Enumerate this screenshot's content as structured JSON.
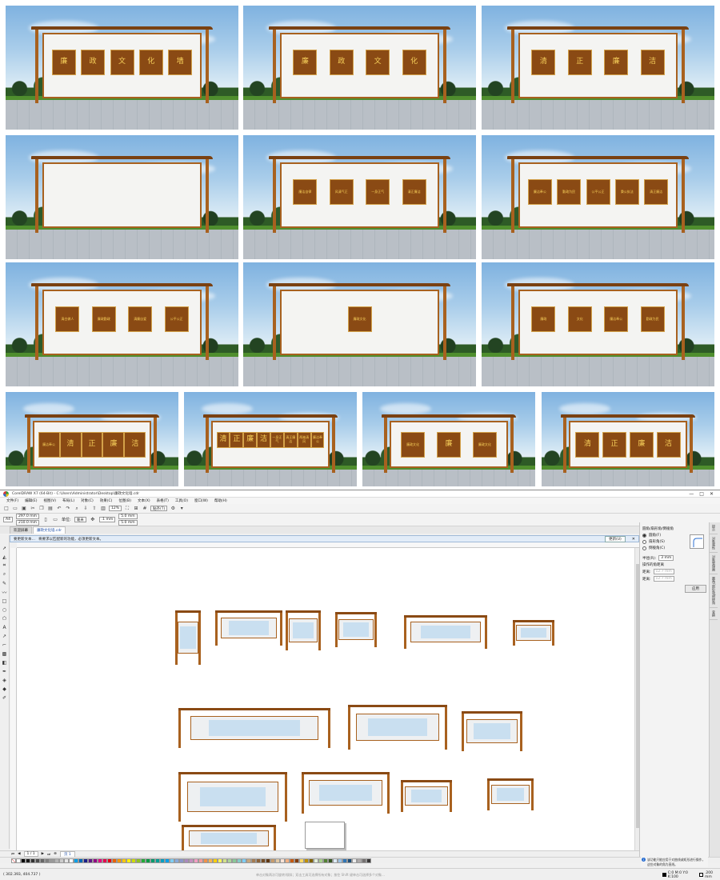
{
  "renders": [
    {
      "id": "r1",
      "signs": [
        "廉",
        "政",
        "文",
        "化",
        "墙"
      ]
    },
    {
      "id": "r2",
      "signs": [
        "廉",
        "政",
        "文",
        "化"
      ]
    },
    {
      "id": "r3",
      "signs": [
        "清",
        "正",
        "廉",
        "洁"
      ]
    },
    {
      "id": "r4",
      "signs": []
    },
    {
      "id": "r5",
      "signs": [
        "廉洁自律",
        "风清气正",
        "一身正气",
        "清正廉洁"
      ]
    },
    {
      "id": "r6",
      "signs": [
        "廉洁奉公",
        "勤政为民",
        "公平公正",
        "秉公执法",
        "清正廉洁"
      ]
    },
    {
      "id": "r7",
      "signs": [
        "清白做人",
        "廉政勤政",
        "清廉自爱",
        "公平公正"
      ]
    },
    {
      "id": "r8",
      "signs": [
        "廉政文化"
      ]
    },
    {
      "id": "r9",
      "signs": [
        "廉政",
        "文化",
        "廉洁奉公",
        "勤政为民"
      ]
    },
    {
      "id": "r10",
      "signs": [
        "廉洁奉公",
        "清",
        "正",
        "廉",
        "洁"
      ]
    },
    {
      "id": "r11",
      "signs": [
        "清",
        "正",
        "廉",
        "洁",
        "一身正气",
        "清正廉洁",
        "两袖清风",
        "廉洁奉公"
      ]
    },
    {
      "id": "r12",
      "signs": [
        "廉政文化",
        "廉",
        "廉政文化"
      ]
    },
    {
      "id": "r13",
      "signs": [
        "清",
        "正",
        "廉",
        "洁"
      ]
    }
  ],
  "app": {
    "title": "CorelDRAW X7 (64-Bit) - C:\\Users\\Administrator\\Desktop\\廉政文化墙.cdr",
    "window_buttons": [
      "—",
      "□",
      "✕"
    ],
    "menu": [
      "文件(F)",
      "编辑(E)",
      "视图(V)",
      "布局(L)",
      "对象(C)",
      "效果(C)",
      "位图(B)",
      "文本(X)",
      "表格(T)",
      "工具(O)",
      "窗口(W)",
      "帮助(H)"
    ],
    "toolbar": {
      "zoom": "12%",
      "snap": "贴齐(T)"
    },
    "propbar": {
      "page_size": "A4",
      "width": "297.0 mm",
      "height": "210.0 mm",
      "units_label": "单位:",
      "units": "毫米",
      "nudge": ".1 mm",
      "dup_x": "5.0 mm",
      "dup_y": "5.0 mm"
    },
    "tabs": [
      "欢迎屏幕",
      "廉政文化墙.cdr"
    ],
    "infobar": {
      "label": "要更新文本…",
      "message": "将要求以匹配新的功能，必须更新文本。",
      "button": "更新(U)",
      "close": "✕"
    },
    "docker": {
      "title": "圆角/扇形角/倒棱角",
      "options": [
        "圆角(F)",
        "扇形角(S)",
        "倒棱角(C)"
      ],
      "selected_option": "圆角(F)",
      "radius_label": "半径(R):",
      "radius": "3 mm",
      "distance_label": "操作的角距离",
      "field_label_1": "距离:",
      "field_value_1": "12.7 mm",
      "field_label_2": "距离:",
      "field_value_2": "12.7 mm",
      "apply": "应用",
      "side_tabs": [
        "提示",
        "对象属性",
        "对象管理器",
        "圆角/扇形角/倒棱角",
        "变换"
      ]
    },
    "pagebar": {
      "page_counter": "1 / 1",
      "page_tab": "页 1"
    },
    "hint": "该功能只能应用于对曲线或矩形进行操作，这些对象的角为直线。",
    "status": {
      "coords": "( 302.393, 404.737 )",
      "middle": "单击对象两次可旋转/倾斜；双击工具可选择所有对象；按住 Shift 键单击可选择多个对象…",
      "fill": "C:0 M:0 Y:0 K:100",
      "outline": ".200 mm"
    },
    "palette_colors": [
      "#ffffff",
      "#000000",
      "#1a1a1a",
      "#333333",
      "#4d4d4d",
      "#666666",
      "#808080",
      "#999999",
      "#b3b3b3",
      "#cccccc",
      "#e6e6e6",
      "#ffffff",
      "#00a0e9",
      "#0068b7",
      "#1d2088",
      "#601986",
      "#920783",
      "#e4007f",
      "#e5004f",
      "#e60012",
      "#eb6100",
      "#f39800",
      "#fcc800",
      "#fff100",
      "#cfdb00",
      "#8fc31f",
      "#22ac38",
      "#009944",
      "#009b6b",
      "#009e96",
      "#00a0c1",
      "#00a0e9",
      "#7ecef4",
      "#88abda",
      "#8c97cb",
      "#aa89bd",
      "#c490bf",
      "#f19ec2",
      "#f29c9f",
      "#f19149",
      "#f8b551",
      "#fdd000",
      "#fff45c",
      "#d3e289",
      "#acd598",
      "#89c997",
      "#84ccc9",
      "#7ecef4",
      "#c7a87e",
      "#a67c52",
      "#8c6239",
      "#754c24",
      "#603813",
      "#c69c6d",
      "#e3c9a4",
      "#fce4d6",
      "#f4b183",
      "#c55a11",
      "#843c0c",
      "#ffd966",
      "#bf9000",
      "#7f6000",
      "#e2efda",
      "#a9d08e",
      "#548235",
      "#375623",
      "#ddebf7",
      "#9bc2e6",
      "#2f75b5",
      "#1f4e78",
      "#ededed",
      "#aeaaaa",
      "#757171",
      "#3a3838"
    ]
  }
}
